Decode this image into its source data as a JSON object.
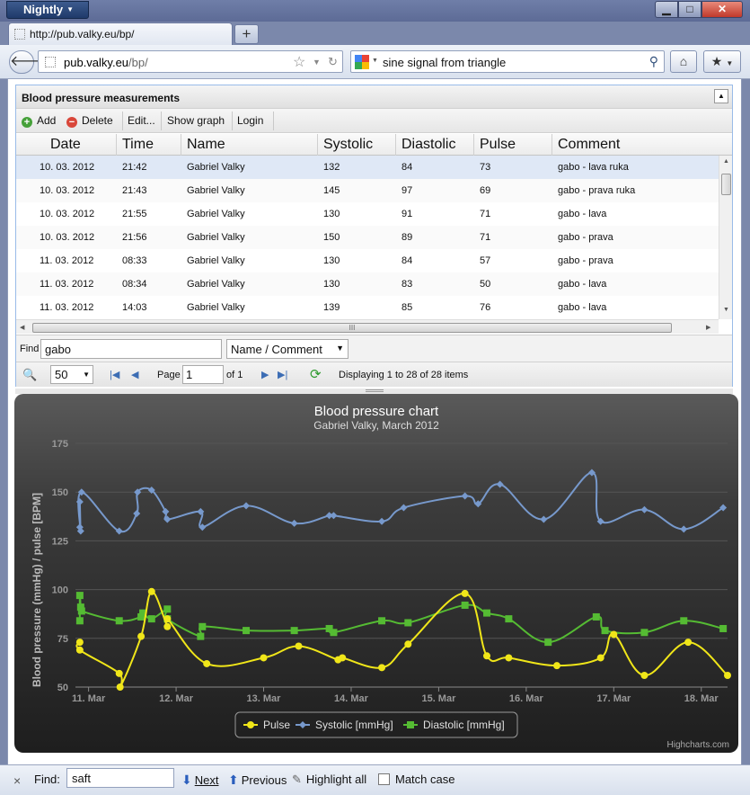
{
  "window": {
    "app_menu": "Nightly",
    "min": "▁",
    "max": "□",
    "close": "✕"
  },
  "tab": {
    "title": "http://pub.valky.eu/bp/",
    "new_tab": "+"
  },
  "navbar": {
    "url_host": "pub.valky.eu",
    "url_path": "/bp/",
    "search_text": "sine signal from triangle"
  },
  "panel": {
    "title": "Blood pressure measurements",
    "toolbar": {
      "add": "Add",
      "delete": "Delete",
      "edit": "Edit...",
      "show_graph": "Show graph",
      "login": "Login"
    },
    "columns": [
      "Date",
      "Time",
      "Name",
      "Systolic",
      "Diastolic",
      "Pulse",
      "Comment"
    ],
    "rows": [
      [
        "10. 03. 2012",
        "21:42",
        "Gabriel Valky",
        "132",
        "84",
        "73",
        "gabo - lava ruka"
      ],
      [
        "10. 03. 2012",
        "21:43",
        "Gabriel Valky",
        "145",
        "97",
        "69",
        "gabo - prava ruka"
      ],
      [
        "10. 03. 2012",
        "21:55",
        "Gabriel Valky",
        "130",
        "91",
        "71",
        "gabo - lava"
      ],
      [
        "10. 03. 2012",
        "21:56",
        "Gabriel Valky",
        "150",
        "89",
        "71",
        "gabo - prava"
      ],
      [
        "11. 03. 2012",
        "08:33",
        "Gabriel Valky",
        "130",
        "84",
        "57",
        "gabo - prava"
      ],
      [
        "11. 03. 2012",
        "08:34",
        "Gabriel Valky",
        "130",
        "83",
        "50",
        "gabo - lava"
      ],
      [
        "11. 03. 2012",
        "14:03",
        "Gabriel Valky",
        "139",
        "85",
        "76",
        "gabo - lava"
      ]
    ],
    "find_label": "Find",
    "find_value": "gabo",
    "find_field": "Name / Comment",
    "page_size": "50",
    "page_label": "Page",
    "page_value": "1",
    "page_of": "of 1",
    "displaying": "Displaying 1 to 28 of 28 items"
  },
  "chart_data": {
    "type": "line",
    "title": "Blood pressure chart",
    "subtitle": "Gabriel Valky, March 2012",
    "ylabel": "Blood pressure (mmHg) / pulse [BPM]",
    "ylim": [
      50,
      175
    ],
    "yticks": [
      50,
      75,
      100,
      125,
      150,
      175
    ],
    "xlim": [
      10.85,
      18.3
    ],
    "xticks": [
      11,
      12,
      13,
      14,
      15,
      16,
      17,
      18
    ],
    "xtick_labels": [
      "11. Mar",
      "12. Mar",
      "13. Mar",
      "14. Mar",
      "15. Mar",
      "16. Mar",
      "17. Mar",
      "18. Mar"
    ],
    "legend_position": "bottom",
    "credits": "Highcharts.com",
    "series": [
      {
        "name": "Pulse",
        "color": "#f0e619",
        "marker": "circle",
        "x": [
          10.9,
          10.9,
          11.35,
          11.36,
          11.6,
          11.72,
          11.9,
          11.9,
          12.35,
          13.0,
          13.4,
          13.85,
          13.9,
          14.35,
          14.65,
          15.3,
          15.55,
          15.8,
          16.35,
          16.85,
          17.0,
          17.35,
          17.85,
          18.3
        ],
        "y": [
          73,
          69,
          57,
          50,
          76,
          99,
          81,
          85,
          62,
          65,
          71,
          64,
          65,
          60,
          72,
          98,
          66,
          65,
          61,
          65,
          77,
          56,
          73,
          56
        ]
      },
      {
        "name": "Systolic [mmHg]",
        "color": "#7799cc",
        "marker": "diamond",
        "x": [
          10.9,
          10.9,
          10.91,
          10.92,
          11.35,
          11.55,
          11.56,
          11.72,
          11.88,
          11.9,
          12.28,
          12.3,
          12.8,
          13.35,
          13.75,
          13.8,
          14.35,
          14.6,
          15.3,
          15.45,
          15.7,
          16.2,
          16.75,
          16.85,
          17.35,
          17.8,
          18.25
        ],
        "y": [
          132,
          145,
          130,
          150,
          130,
          139,
          150,
          151,
          140,
          136,
          140,
          132,
          143,
          134,
          138,
          138,
          135,
          142,
          148,
          144,
          154,
          136,
          160,
          135,
          141,
          131,
          142
        ]
      },
      {
        "name": "Diastolic [mmHg]",
        "color": "#55bb33",
        "marker": "square",
        "x": [
          10.9,
          10.9,
          10.91,
          10.92,
          11.35,
          11.6,
          11.62,
          11.72,
          11.9,
          11.9,
          12.28,
          12.3,
          12.8,
          13.35,
          13.75,
          13.8,
          14.35,
          14.65,
          15.3,
          15.55,
          15.8,
          16.25,
          16.8,
          16.9,
          17.35,
          17.8,
          18.25
        ],
        "y": [
          84,
          97,
          91,
          89,
          84,
          86,
          88,
          85,
          90,
          85,
          76,
          81,
          79,
          79,
          80,
          78,
          84,
          83,
          92,
          88,
          85,
          73,
          86,
          79,
          78,
          84,
          80
        ]
      }
    ]
  },
  "findbar": {
    "close": "×",
    "label": "Find:",
    "value": "saft",
    "next": "Next",
    "previous": "Previous",
    "highlight": "Highlight all",
    "match_case": "Match case"
  }
}
